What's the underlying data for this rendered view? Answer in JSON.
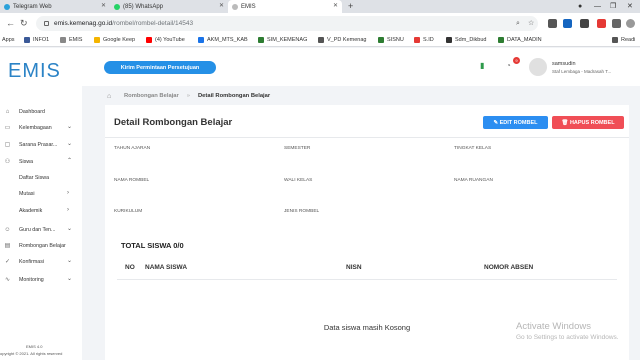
{
  "browser": {
    "tabs": [
      {
        "title": "Telegram Web",
        "color": "#2aa1da",
        "active": false
      },
      {
        "title": "(85) WhatsApp",
        "color": "#25d366",
        "active": false
      },
      {
        "title": "EMIS",
        "color": "#aaaaaa",
        "active": true
      }
    ],
    "new_tab": "+",
    "url_domain": "emis.kemenag.go.id",
    "url_path": "/rombel/rombel-detail/14543",
    "bookmarks": [
      {
        "label": "Apps",
        "color": "#4285f4"
      },
      {
        "label": "INFO1",
        "color": "#3b5998"
      },
      {
        "label": "EMIS",
        "color": "#888888"
      },
      {
        "label": "Google Keep",
        "color": "#f4b400"
      },
      {
        "label": "(4) YouTube",
        "color": "#ff0000"
      },
      {
        "label": "AKM_MTS_KAB",
        "color": "#1a73e8"
      },
      {
        "label": "SIM_KEMENAG",
        "color": "#2e7d32"
      },
      {
        "label": "V_PD Kemenag",
        "color": "#555555"
      },
      {
        "label": "SISNU",
        "color": "#2e7d32"
      },
      {
        "label": "S.ID",
        "color": "#e53935"
      },
      {
        "label": "Sdm_Dikbud",
        "color": "#333333"
      },
      {
        "label": "DATA_MADIN",
        "color": "#2e7d32"
      },
      {
        "label": "Readi",
        "color": "#555555"
      }
    ]
  },
  "app": {
    "logo": "EMIS",
    "kirim_button": "Kirim Permintaan Persetujuan",
    "notification_count": "9",
    "user": {
      "name": "samsudin",
      "role": "Staf Lembaga - Madrasah T..."
    },
    "sidebar": [
      {
        "label": "Dashboard",
        "icon": "home-icon",
        "chevron": false
      },
      {
        "label": "Kelembagaan",
        "icon": "building-icon",
        "chevron": true
      },
      {
        "label": "Sarana Prasar...",
        "icon": "box-icon",
        "chevron": true
      },
      {
        "label": "Siswa",
        "icon": "users-icon",
        "chevron": true,
        "expanded": true
      },
      {
        "label": "Guru dan Ten...",
        "icon": "teacher-icon",
        "chevron": true
      },
      {
        "label": "Rombongan Belajar",
        "icon": "class-icon",
        "chevron": false
      },
      {
        "label": "Konfirmasi",
        "icon": "check-icon",
        "chevron": true
      },
      {
        "label": "Monitoring",
        "icon": "chart-icon",
        "chevron": true
      }
    ],
    "siswa_sub": [
      {
        "label": "Daftar Siswa",
        "chevron": false
      },
      {
        "label": "Mutasi",
        "chevron": true
      },
      {
        "label": "Akademik",
        "chevron": true
      }
    ],
    "footer_version": "EMIS 4.0",
    "footer_copyright": "opyright © 2021. All rights reserved",
    "breadcrumb": {
      "parent": "Rombongan Belajar",
      "current": "Detail Rombongan Belajar"
    },
    "card": {
      "title": "Detail Rombongan Belajar",
      "edit_button": "EDIT ROMBEL",
      "hapus_button": "HAPUS ROMBEL",
      "fields": [
        "TAHUN AJARAN",
        "SEMESTER",
        "TINGKAT KELAS",
        "NAMA ROMBEL",
        "WALI KELAS",
        "NAMA RUANGAN",
        "KURIKULUM",
        "JENIS ROMBEL"
      ],
      "total_label": "TOTAL SISWA 0/0",
      "columns": [
        "NO",
        "NAMA SISWA",
        "NISN",
        "NOMOR ABSEN"
      ],
      "empty_message": "Data siswa masih Kosong"
    }
  },
  "watermark": {
    "line1": "Activate Windows",
    "line2": "Go to Settings to activate Windows."
  }
}
